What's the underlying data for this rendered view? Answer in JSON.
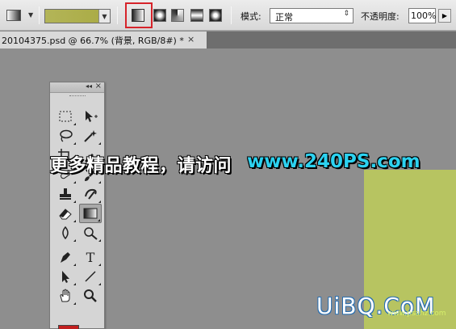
{
  "options_bar": {
    "gradient_colors": [
      "#b3b558",
      "#a9aa43"
    ],
    "gradient_types": [
      {
        "name": "linear-gradient",
        "selected": true
      },
      {
        "name": "radial-gradient",
        "selected": false
      },
      {
        "name": "angle-gradient",
        "selected": false
      },
      {
        "name": "reflected-gradient",
        "selected": false
      },
      {
        "name": "diamond-gradient",
        "selected": false
      }
    ],
    "mode_label": "模式:",
    "mode_value": "正常",
    "opacity_label": "不透明度:",
    "opacity_value": "100%",
    "highlight_color": "#d6232a"
  },
  "document_tab": {
    "title": "20104375.psd @ 66.7% (背景, RGB/8#) *",
    "close_glyph": "×"
  },
  "canvas": {
    "background": "#8e8e8e",
    "document_color": "#b7c461"
  },
  "tools_panel": {
    "collapse_glyph": "◂◂",
    "close_glyph": "×",
    "tools": [
      {
        "name": "marquee-tool"
      },
      {
        "name": "move-tool"
      },
      {
        "name": "lasso-tool"
      },
      {
        "name": "magic-wand-tool"
      },
      {
        "name": "crop-tool"
      },
      {
        "name": "eyedropper-tool"
      },
      {
        "name": "healing-brush-tool"
      },
      {
        "name": "brush-tool"
      },
      {
        "name": "clone-stamp-tool"
      },
      {
        "name": "history-brush-tool"
      },
      {
        "name": "eraser-tool"
      },
      {
        "name": "gradient-tool",
        "active": true
      },
      {
        "name": "blur-tool"
      },
      {
        "name": "dodge-tool"
      },
      {
        "name": "pen-tool"
      },
      {
        "name": "type-tool",
        "glyph": "T"
      },
      {
        "name": "path-selection-tool"
      },
      {
        "name": "line-tool"
      },
      {
        "name": "hand-tool"
      },
      {
        "name": "zoom-tool"
      }
    ],
    "foreground_color": "#c21f1f"
  },
  "overlay": {
    "banner_text": "更多精品教程，请访问",
    "banner_url": "www.240PS.com"
  },
  "watermark": {
    "logo_text": "UiBQ.CoM",
    "small_text": "www.psahz.com"
  }
}
